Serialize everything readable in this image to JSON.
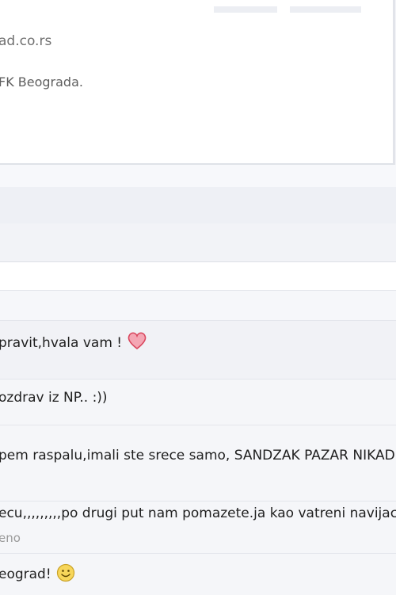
{
  "post": {
    "url": "ad.co.rs",
    "description": "FK Beograda."
  },
  "comments": [
    {
      "text": "pravit,hvala vam !",
      "icon": "heart-icon"
    },
    {
      "text": "ozdrav iz NP.. :))"
    },
    {
      "text": "pem raspalu,imali ste srece samo, SANDZAK PAZAR NIKAD S"
    },
    {
      "text": "ecu,,,,,,,,,po drugi put nam pomazete.ja kao vatreni navijac",
      "meta": "eno"
    },
    {
      "text": "eograd!",
      "icon": "smiley-icon"
    }
  ],
  "colors": {
    "heart": "#e0566e",
    "smiley": "#f2c94c"
  }
}
